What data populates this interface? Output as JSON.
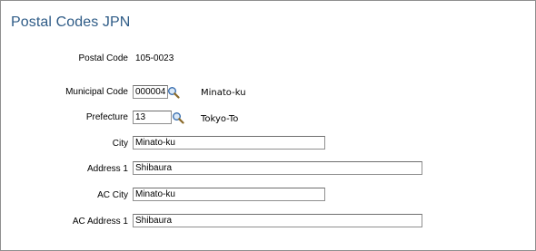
{
  "page": {
    "title": "Postal Codes JPN"
  },
  "fields": {
    "postal_code": {
      "label": "Postal Code",
      "value": "105-0023"
    },
    "municipal_code": {
      "label": "Municipal Code",
      "value": "000004",
      "description": "Minato-ku"
    },
    "prefecture": {
      "label": "Prefecture",
      "value": "13",
      "description": "Tokyo-To"
    },
    "city": {
      "label": "City",
      "value": "Minato-ku"
    },
    "address1": {
      "label": "Address 1",
      "value": "Shibaura"
    },
    "ac_city": {
      "label": "AC City",
      "value": "Minato-ku"
    },
    "ac_address1": {
      "label": "AC Address 1",
      "value": "Shibaura"
    }
  },
  "icons": {
    "lookup": "magnifier-lookup-icon"
  },
  "colors": {
    "title": "#2f5c87",
    "border": "#8f8f8f"
  }
}
